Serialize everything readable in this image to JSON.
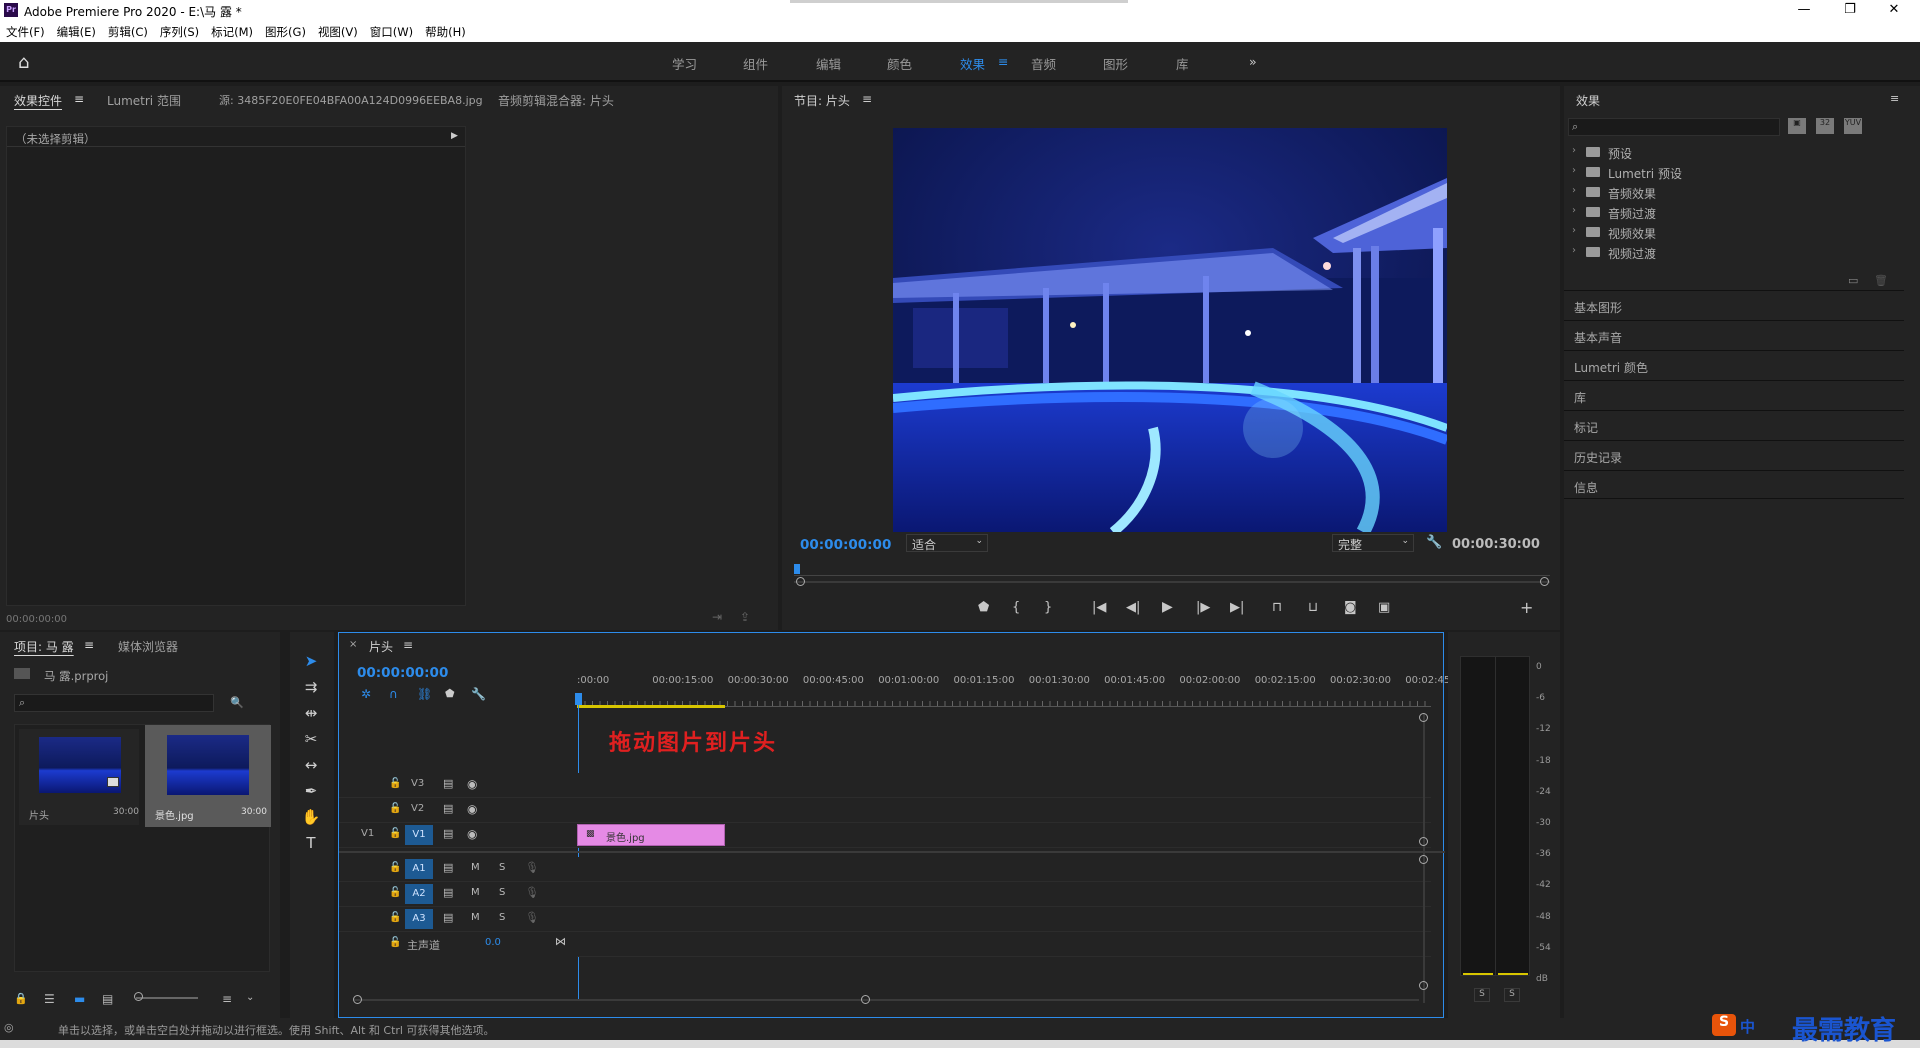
{
  "window": {
    "title": "Adobe Premiere Pro 2020 - E:\\马 露 *",
    "logo": "Pr",
    "minimize": "—",
    "restore": "❐",
    "close": "✕"
  },
  "menu": [
    "文件(F)",
    "编辑(E)",
    "剪辑(C)",
    "序列(S)",
    "标记(M)",
    "图形(G)",
    "视图(V)",
    "窗口(W)",
    "帮助(H)"
  ],
  "workspaces": {
    "tabs": [
      "学习",
      "组件",
      "编辑",
      "颜色",
      "效果",
      "音频",
      "图形",
      "库"
    ],
    "active": "效果",
    "more": "»",
    "menu_icon": "≡"
  },
  "source_panel": {
    "tabs": [
      "效果控件",
      "Lumetri 范围",
      "源: 3485F20E0FE04BFA00A124D0996EEBA8.jpg",
      "音频剪辑混合器: 片头"
    ],
    "menu_icon": "≡",
    "no_clip": "（未选择剪辑）",
    "timecode": "00:00:00:00"
  },
  "program_monitor": {
    "title": "节目: 片头",
    "menu_icon": "≡",
    "timecode": "00:00:00:00",
    "fit_option": "适合",
    "quality": "完整",
    "duration": "00:00:30:00",
    "playhead_fraction": 0.0
  },
  "effects_panel": {
    "title": "效果",
    "search_placeholder": "",
    "folders": [
      "预设",
      "Lumetri 预设",
      "音频效果",
      "音频过渡",
      "视频效果",
      "视频过渡"
    ],
    "collapsed_panels": [
      "基本图形",
      "基本声音",
      "Lumetri 颜色",
      "库",
      "标记",
      "历史记录",
      "信息"
    ]
  },
  "project_panel": {
    "tabs": [
      "项目: 马 露",
      "媒体浏览器"
    ],
    "menu_icon": "≡",
    "project_file": "马 露.prproj",
    "items": [
      {
        "name": "片头",
        "duration": "30:00"
      },
      {
        "name": "景色.jpg",
        "duration": "30:00"
      }
    ]
  },
  "timeline": {
    "sequence_tab": "片头",
    "close_icon": "×",
    "menu_icon": "≡",
    "timecode": "00:00:00:00",
    "ruler": [
      ":00:00",
      "00:00:15:00",
      "00:00:30:00",
      "00:00:45:00",
      "00:01:00:00",
      "00:01:15:00",
      "00:01:30:00",
      "00:01:45:00",
      "00:02:00:00",
      "00:02:15:00",
      "00:02:30:00",
      "00:02:45:"
    ],
    "annotation": "拖动图片到片头",
    "video_tracks": [
      "V3",
      "V2",
      "V1"
    ],
    "source_patch": "V1",
    "audio_tracks": [
      "A1",
      "A2",
      "A3"
    ],
    "mute": "M",
    "solo": "S",
    "master_label": "主声道",
    "master_value": "0.0",
    "clip_name": "景色.jpg"
  },
  "audio_meter": {
    "scale": [
      "0",
      "-6",
      "-12",
      "-18",
      "-24",
      "-30",
      "-36",
      "-42",
      "-48",
      "-54",
      "dB"
    ],
    "solo_buttons": [
      "S",
      "S"
    ]
  },
  "status_bar": {
    "hint": "单击以选择，或单击空白处并拖动以进行框选。使用 Shift、Alt 和 Ctrl 可获得其他选项。"
  },
  "watermark": {
    "ime": "中",
    "brand": "最需教育"
  },
  "colors": {
    "accent": "#2d8ceb",
    "clip": "#e58ae5",
    "annotation": "#e02020",
    "panel_bg": "#232323",
    "frame_bg": "#1d1d1d"
  }
}
